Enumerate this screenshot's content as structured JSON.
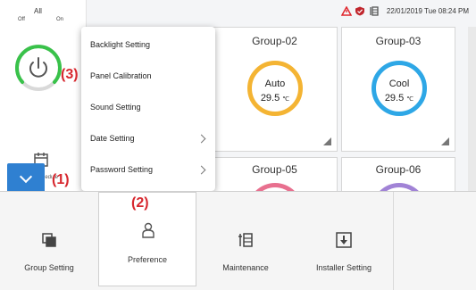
{
  "status_bar": {
    "datetime": "22/01/2019 Tue 08:24 PM",
    "icons": [
      "warning-icon",
      "shield-icon",
      "filter-icon"
    ]
  },
  "left_panel": {
    "all_label": "All",
    "off_label": "Off",
    "on_label": "On",
    "schedule_label": "Schedule"
  },
  "groups": [
    {
      "name": "Group-02",
      "mode": "Auto",
      "temp": "29.5",
      "unit": "℃",
      "ring_color": "#f4b433"
    },
    {
      "name": "Group-03",
      "mode": "Cool",
      "temp": "29.5",
      "unit": "℃",
      "ring_color": "#2ea7e6"
    },
    {
      "name": "Group-05",
      "ring_color": "#e8708f"
    },
    {
      "name": "Group-06",
      "ring_color": "#a183d6"
    }
  ],
  "menu": {
    "items": [
      {
        "label": "Backlight Setting",
        "has_submenu": false
      },
      {
        "label": "Panel Calibration",
        "has_submenu": false
      },
      {
        "label": "Sound Setting",
        "has_submenu": false
      },
      {
        "label": "Date Setting",
        "has_submenu": true
      },
      {
        "label": "Password Setting",
        "has_submenu": true
      }
    ]
  },
  "callouts": {
    "one": "(1)",
    "two": "(2)",
    "three": "(3)"
  },
  "toolbar": {
    "items": [
      {
        "label": "Group Setting",
        "icon": "group-setting-icon",
        "active": false
      },
      {
        "label": "Preference",
        "icon": "preference-icon",
        "active": true
      },
      {
        "label": "Maintenance",
        "icon": "maintenance-icon",
        "active": false
      },
      {
        "label": "Installer Setting",
        "icon": "installer-setting-icon",
        "active": false
      }
    ]
  },
  "colors": {
    "accent": "#2f80d1",
    "callout": "#d7282f",
    "power_ring": "#39c24a",
    "warning": "#e0262d"
  }
}
